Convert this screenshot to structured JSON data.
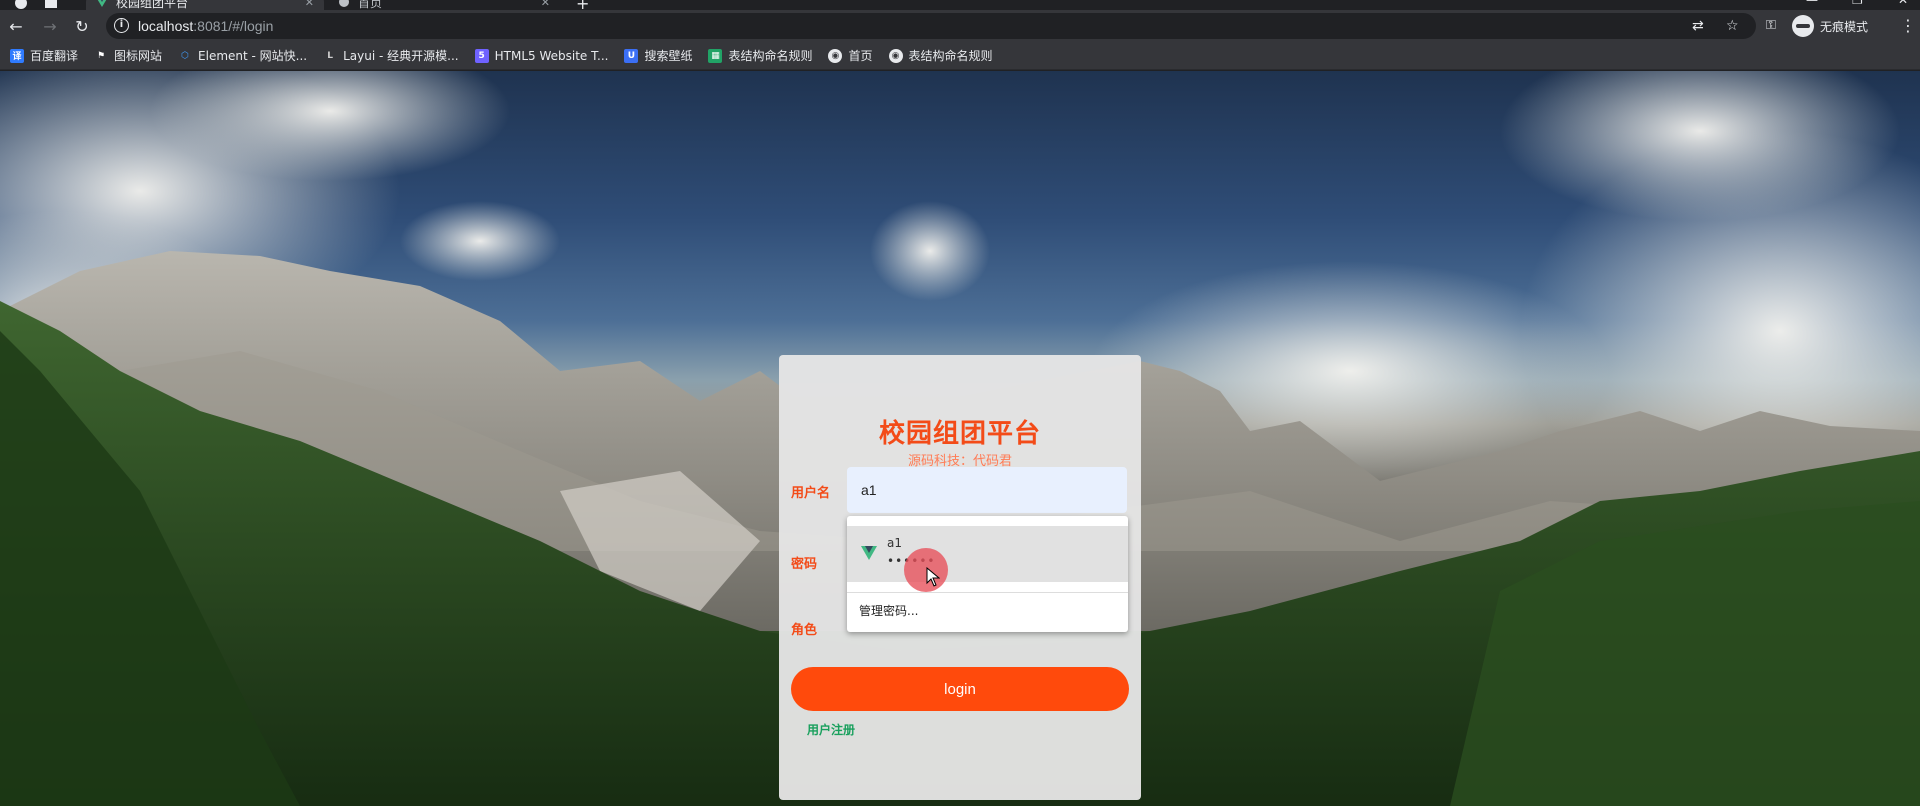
{
  "browser": {
    "tabs": [
      {
        "title": "校园组团平台",
        "active": true
      },
      {
        "title": "首页",
        "active": false
      }
    ],
    "new_tab": "+",
    "url_host": "localhost",
    "url_rest": ":8081/#/login",
    "incognito_label": "无痕模式",
    "bookmarks": [
      {
        "label": "百度翻译",
        "icon": "baidu-translate-icon",
        "color": "#2f7bff"
      },
      {
        "label": "图标网站",
        "icon": "flag-icon",
        "color": "#ffffff"
      },
      {
        "label": "Element - 网站快...",
        "icon": "element-icon",
        "color": "#409eff"
      },
      {
        "label": "Layui - 经典开源模...",
        "icon": "layui-icon",
        "color": "#cfcfcf"
      },
      {
        "label": "HTML5 Website T...",
        "icon": "html5-icon",
        "color": "#6f62ff"
      },
      {
        "label": "搜索壁纸",
        "icon": "wallpaper-icon",
        "color": "#3b6ff5"
      },
      {
        "label": "表结构命名规则",
        "icon": "sheet-icon",
        "color": "#21a366"
      },
      {
        "label": "首页",
        "icon": "globe-icon",
        "color": "#e8eaed"
      },
      {
        "label": "表结构命名规则",
        "icon": "globe-icon",
        "color": "#e8eaed"
      }
    ]
  },
  "login": {
    "title": "校园组团平台",
    "subtitle": "源码科技：代码君",
    "username_label": "用户名",
    "username_value": "a1",
    "password_label": "密码",
    "role_label": "角色",
    "login_button": "login",
    "register_link": "用户注册"
  },
  "autofill": {
    "username": "a1",
    "password_mask": "••••••",
    "manage_label": "管理密码..."
  },
  "colors": {
    "accent": "#ff4a0c",
    "title": "#f34b18",
    "register": "#19a05d"
  }
}
